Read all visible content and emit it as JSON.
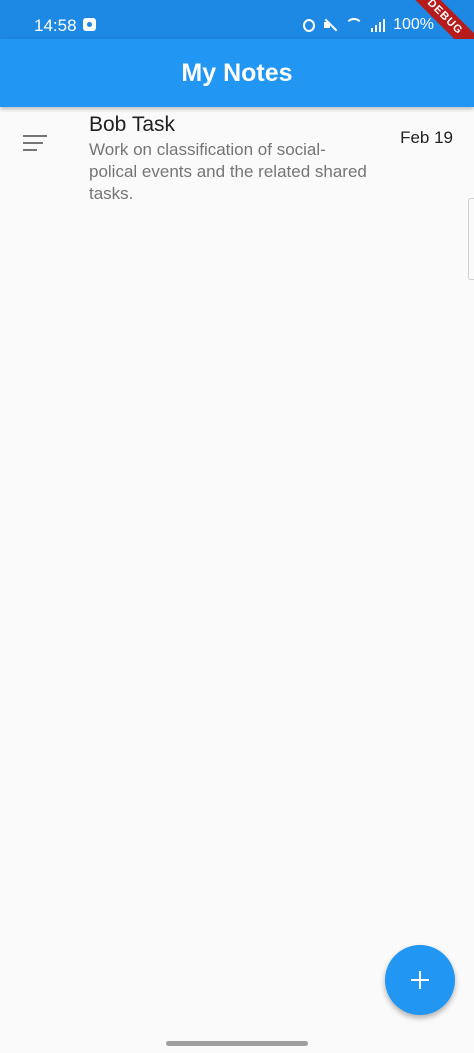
{
  "status_bar": {
    "time": "14:58",
    "battery": "100%",
    "debug_label": "DEBUG",
    "color": "#1e88e5"
  },
  "app_bar": {
    "title": "My Notes",
    "color": "#2196f3"
  },
  "notes": [
    {
      "title": "Bob Task",
      "description": "Work on classification of social-polical events and the related shared tasks.",
      "date": "Feb 19",
      "icon": "notes-list-icon"
    }
  ],
  "fab": {
    "icon": "add-icon",
    "color": "#2196f3"
  }
}
